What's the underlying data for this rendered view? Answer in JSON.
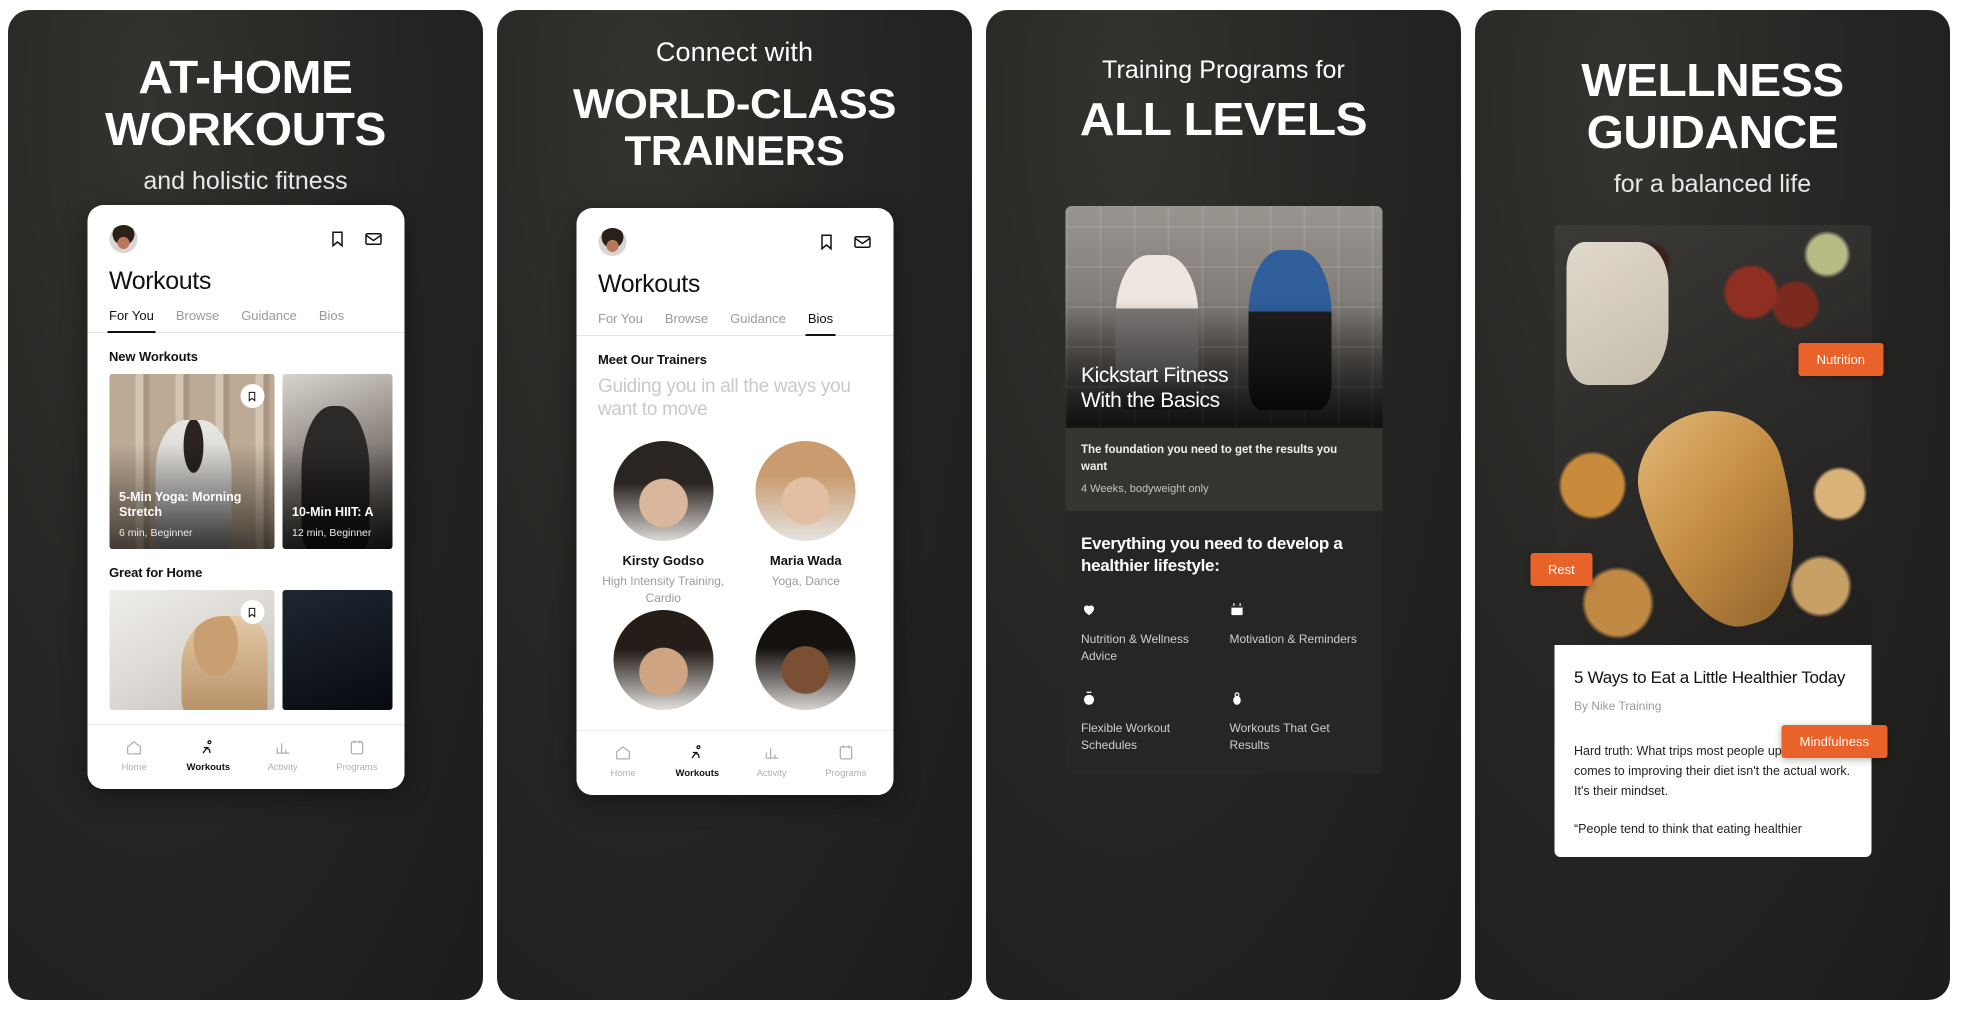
{
  "brand": {
    "accent": "#e8622a",
    "dark_bg": "#262624",
    "light_bg": "#ffffff"
  },
  "panels": [
    {
      "id": "panel-at-home-workouts",
      "headline_big": "AT-HOME WORKOUTS",
      "headline_sub": "and holistic fitness",
      "app": {
        "title": "Workouts",
        "tabs": [
          {
            "label": "For You",
            "active": true
          },
          {
            "label": "Browse",
            "active": false
          },
          {
            "label": "Guidance",
            "active": false
          },
          {
            "label": "Bios",
            "active": false
          }
        ],
        "sections": [
          {
            "heading": "New Workouts",
            "cards": [
              {
                "title": "5-Min Yoga: Morning Stretch",
                "meta": "6 min, Beginner",
                "bookmark": true
              },
              {
                "title": "10-Min HIIT: A",
                "meta": "12 min, Beginner",
                "bookmark": false
              }
            ]
          },
          {
            "heading": "Great for Home",
            "cards": [
              {
                "title": "",
                "meta": "",
                "bookmark": true
              },
              {
                "title": "",
                "meta": "",
                "bookmark": false
              }
            ]
          }
        ],
        "nav": [
          {
            "label": "Home",
            "icon": "home-icon",
            "active": false
          },
          {
            "label": "Workouts",
            "icon": "workouts-icon",
            "active": true
          },
          {
            "label": "Activity",
            "icon": "activity-icon",
            "active": false
          },
          {
            "label": "Programs",
            "icon": "programs-icon",
            "active": false
          }
        ]
      }
    },
    {
      "id": "panel-world-class-trainers",
      "headline_kicker": "Connect with",
      "headline_big_line1": "WORLD-CLASS",
      "headline_big_line2": "TRAINERS",
      "app": {
        "title": "Workouts",
        "tabs": [
          {
            "label": "For You",
            "active": false
          },
          {
            "label": "Browse",
            "active": false
          },
          {
            "label": "Guidance",
            "active": false
          },
          {
            "label": "Bios",
            "active": true
          }
        ],
        "section_heading": "Meet Our Trainers",
        "lede": "Guiding you in all the ways you want to move",
        "trainers": [
          {
            "name": "Kirsty Godso",
            "specialty": "High Intensity Training, Cardio"
          },
          {
            "name": "Maria Wada",
            "specialty": "Yoga, Dance"
          },
          {
            "name": "",
            "specialty": ""
          },
          {
            "name": "",
            "specialty": ""
          }
        ],
        "nav": [
          {
            "label": "Home",
            "icon": "home-icon",
            "active": false
          },
          {
            "label": "Workouts",
            "icon": "workouts-icon",
            "active": true
          },
          {
            "label": "Activity",
            "icon": "activity-icon",
            "active": false
          },
          {
            "label": "Programs",
            "icon": "programs-icon",
            "active": false
          }
        ]
      }
    },
    {
      "id": "panel-all-levels",
      "headline_kicker": "Training Programs for",
      "headline_big": "ALL LEVELS",
      "app": {
        "hero_title_line1": "Kickstart Fitness",
        "hero_title_line2": "With the Basics",
        "hero_desc": "The foundation you need to get the results you want",
        "hero_meta": "4 Weeks, bodyweight only",
        "features_heading": "Everything you need to develop a healthier lifestyle:",
        "features": [
          {
            "icon": "heart-icon",
            "label": "Nutrition & Wellness Advice"
          },
          {
            "icon": "calendar-icon",
            "label": "Motivation & Reminders"
          },
          {
            "icon": "stopwatch-icon",
            "label": "Flexible Workout Schedules"
          },
          {
            "icon": "kettlebell-icon",
            "label": "Workouts That Get Results"
          }
        ]
      }
    },
    {
      "id": "panel-wellness-guidance",
      "headline_big": "WELLNESS GUIDANCE",
      "headline_sub": "for a balanced life",
      "app": {
        "pills": [
          {
            "label": "Nutrition"
          },
          {
            "label": "Rest"
          },
          {
            "label": "Mindfulness"
          }
        ],
        "article": {
          "title": "5 Ways to Eat a Little Healthier Today",
          "byline": "By Nike Training",
          "body": "Hard truth: What trips most people up when it comes to improving their diet isn't the actual work. It's their mindset.",
          "quote": "“People tend to think that eating healthier"
        }
      }
    }
  ]
}
